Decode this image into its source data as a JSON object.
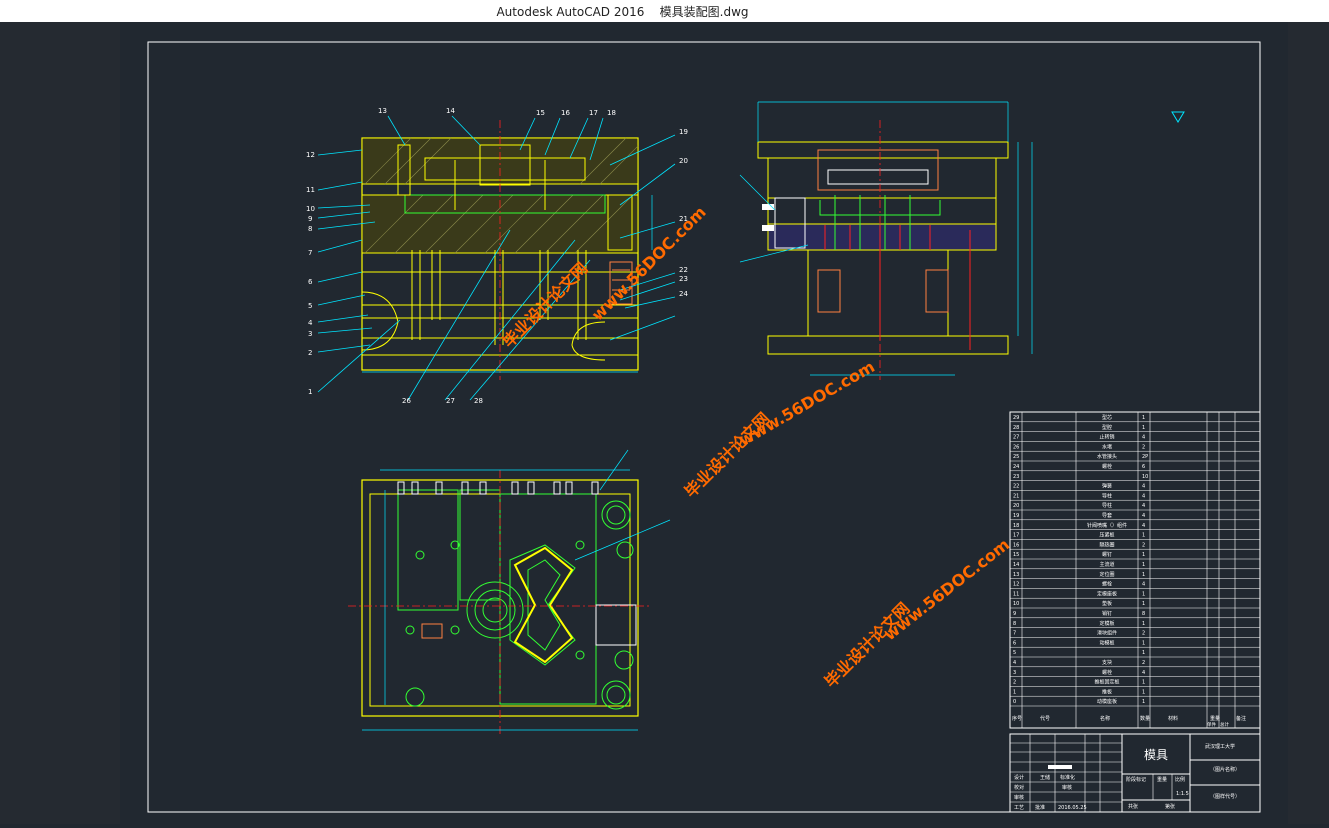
{
  "window": {
    "title_app": "Autodesk AutoCAD 2016",
    "title_file": "模具装配图.dwg"
  },
  "watermark": {
    "cn": "毕业设计论文网",
    "url": "www.56DOC.com"
  },
  "callouts": [
    "1",
    "2",
    "3",
    "4",
    "5",
    "6",
    "7",
    "8",
    "9",
    "10",
    "11",
    "12",
    "13",
    "14",
    "15",
    "16",
    "17",
    "18",
    "19",
    "20",
    "21",
    "22",
    "23",
    "24",
    "26",
    "27",
    "28"
  ],
  "bom": {
    "rows": [
      {
        "no": "29",
        "name": "型芯",
        "qty": "1"
      },
      {
        "no": "28",
        "name": "型腔",
        "qty": "1"
      },
      {
        "no": "27",
        "name": "止转销",
        "qty": "4"
      },
      {
        "no": "26",
        "name": "水堵",
        "qty": "2"
      },
      {
        "no": "25",
        "name": "水管接头",
        "qty": "2P"
      },
      {
        "no": "24",
        "name": "螺栓",
        "qty": "6"
      },
      {
        "no": "23",
        "name": "",
        "qty": "10"
      },
      {
        "no": "22",
        "name": "弹簧",
        "qty": "4"
      },
      {
        "no": "21",
        "name": "导柱",
        "qty": "4"
      },
      {
        "no": "20",
        "name": "导柱",
        "qty": "4"
      },
      {
        "no": "19",
        "name": "导套",
        "qty": "4"
      },
      {
        "no": "18",
        "name": "针阀喷嘴（）组件",
        "qty": "4"
      },
      {
        "no": "17",
        "name": "压紧板",
        "qty": "1"
      },
      {
        "no": "16",
        "name": "隔热圈",
        "qty": "2"
      },
      {
        "no": "15",
        "name": "螺钉",
        "qty": "1"
      },
      {
        "no": "14",
        "name": "主流道",
        "qty": "1"
      },
      {
        "no": "13",
        "name": "定位圈",
        "qty": "1"
      },
      {
        "no": "12",
        "name": "螺栓",
        "qty": "4"
      },
      {
        "no": "11",
        "name": "定模座板",
        "qty": "1"
      },
      {
        "no": "10",
        "name": "垫板",
        "qty": "1"
      },
      {
        "no": "9",
        "name": "销钉",
        "qty": "8"
      },
      {
        "no": "8",
        "name": "定模板",
        "qty": "1"
      },
      {
        "no": "7",
        "name": "滑块组件",
        "qty": "2"
      },
      {
        "no": "6",
        "name": "动模板",
        "qty": "1"
      },
      {
        "no": "5",
        "name": "",
        "qty": "1"
      },
      {
        "no": "4",
        "name": "支块",
        "qty": "2"
      },
      {
        "no": "3",
        "name": "螺栓",
        "qty": "4"
      },
      {
        "no": "2",
        "name": "推板固定板",
        "qty": "1"
      },
      {
        "no": "1",
        "name": "推板",
        "qty": "1"
      },
      {
        "no": "0",
        "name": "动模座板",
        "qty": "1"
      }
    ],
    "header": {
      "no": "序号",
      "code": "代号",
      "name": "名称",
      "qty": "数量",
      "material": "材料",
      "weight": "重量",
      "single": "单件",
      "total": "总计",
      "remark": "备注"
    }
  },
  "title_block": {
    "part_name": "模具",
    "school": "武汉理工大学",
    "drawing_name": "（图片名称）",
    "drawing_code": "（图样代号）",
    "design": "设计",
    "designer": "王储",
    "standardize": "标准化",
    "check": "校对",
    "review": "审核",
    "approve": "审核",
    "craft": "工艺",
    "date_label": "批准",
    "date": "2016.05.25",
    "stage_mark": "阶段标记",
    "weight": "重量",
    "scale": "比例",
    "scale_val": "1:1.5",
    "sheets_total": "共张",
    "sheet": "第张"
  },
  "colors": {
    "yellow": "#ffff00",
    "cyan": "#00e5ff",
    "green": "#33ff33",
    "red": "#ff2020",
    "white": "#ffffff",
    "watermark": "#ff6a00"
  }
}
